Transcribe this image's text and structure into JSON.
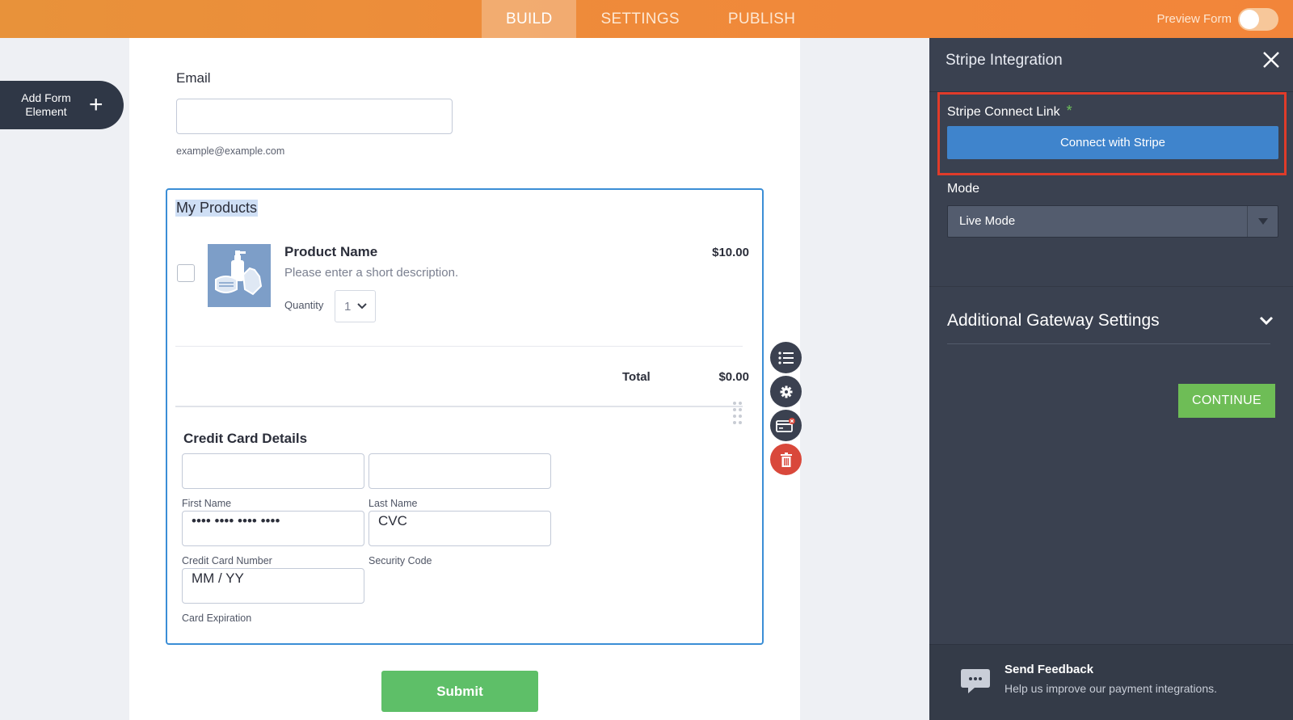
{
  "topbar": {
    "tabs": [
      "BUILD",
      "SETTINGS",
      "PUBLISH"
    ],
    "active_tab": "BUILD",
    "preview_label": "Preview Form",
    "preview_on": false
  },
  "sidebar": {
    "add_element_line1": "Add Form",
    "add_element_line2": "Element"
  },
  "form": {
    "email_label": "Email",
    "email_value": "",
    "email_hint": "example@example.com",
    "products_title": "My Products",
    "product": {
      "name": "Product Name",
      "description": "Please enter a short description.",
      "price": "$10.00",
      "quantity_label": "Quantity",
      "quantity_value": "1",
      "selected": false
    },
    "total_label": "Total",
    "total_value": "$0.00",
    "cc_title": "Credit Card Details",
    "first_name_label": "First Name",
    "last_name_label": "Last Name",
    "card_number_value": "•••• •••• •••• ••••",
    "card_number_label": "Credit Card Number",
    "cvc_value": "CVC",
    "cvc_label": "Security Code",
    "expiry_value": "MM / YY",
    "expiry_label": "Card Expiration",
    "submit_label": "Submit"
  },
  "tools": [
    "list-icon",
    "gear-icon",
    "card-remove-icon",
    "trash-icon"
  ],
  "panel": {
    "title": "Stripe Integration",
    "connect_label": "Stripe Connect Link",
    "required_mark": "*",
    "connect_button": "Connect with Stripe",
    "mode_label": "Mode",
    "mode_value": "Live Mode",
    "additional_settings": "Additional Gateway Settings",
    "continue_button": "CONTINUE",
    "feedback_title": "Send Feedback",
    "feedback_sub": "Help us improve our payment integrations."
  },
  "colors": {
    "topbar": "#ef8a3a",
    "panel_bg": "#3a4150",
    "connect_button": "#3f84cc",
    "continue_button": "#6ebd56",
    "submit_button": "#5ebf68",
    "highlight_border": "#e03b2a",
    "selection_border": "#3b8ed6"
  }
}
